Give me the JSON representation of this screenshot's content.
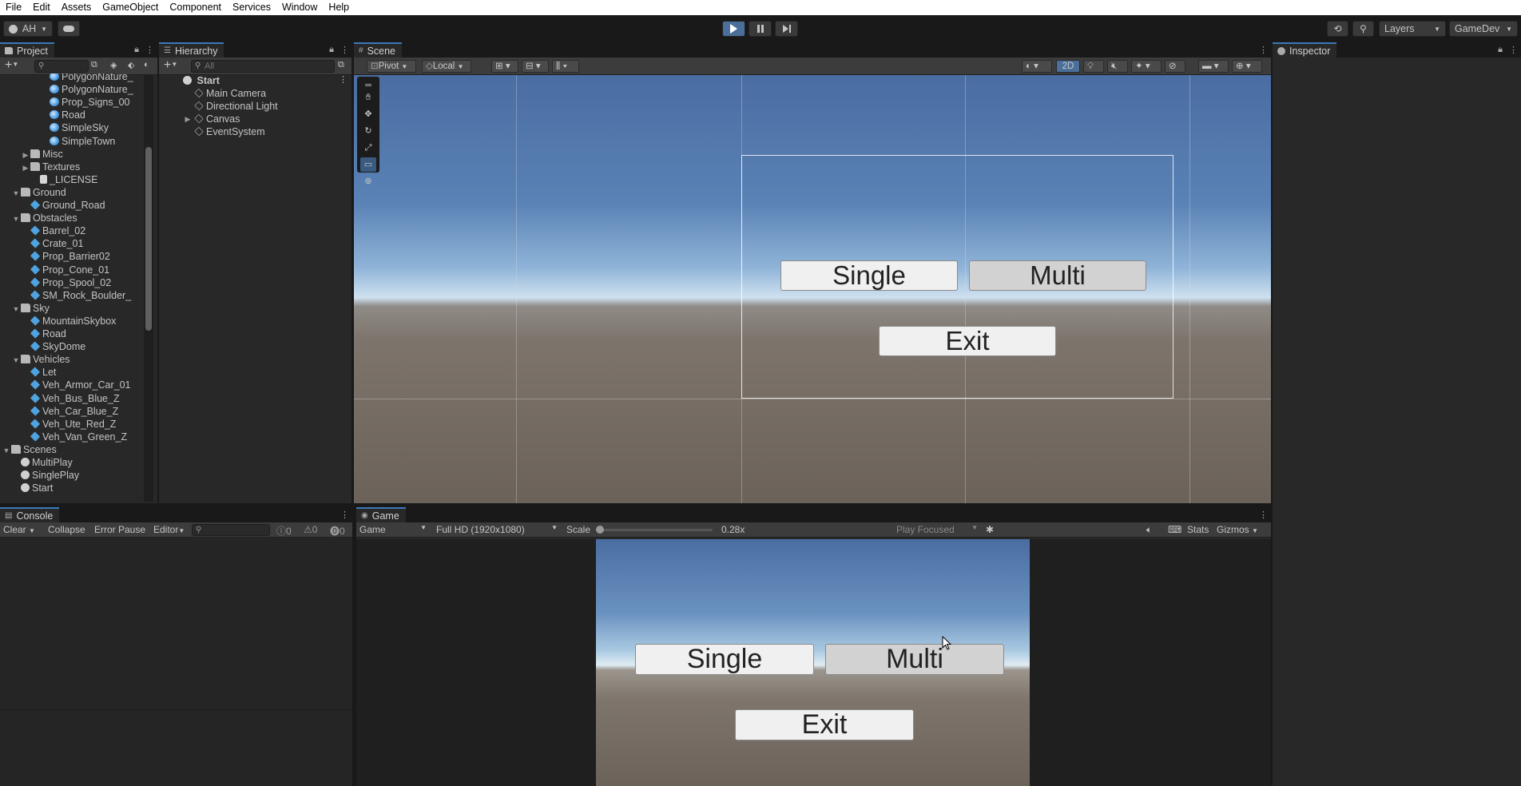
{
  "menu": [
    "File",
    "Edit",
    "Assets",
    "GameObject",
    "Component",
    "Services",
    "Window",
    "Help"
  ],
  "toolbar": {
    "account": "AH",
    "layers": "Layers",
    "layout": "GameDev"
  },
  "project": {
    "tab": "Project",
    "rows": [
      {
        "label": "PolygonNature_",
        "icon": "mat",
        "indent": 5
      },
      {
        "label": "PolygonNature_",
        "icon": "mat",
        "indent": 5
      },
      {
        "label": "Prop_Signs_00",
        "icon": "mat",
        "indent": 5
      },
      {
        "label": "Road",
        "icon": "mat",
        "indent": 5
      },
      {
        "label": "SimpleSky",
        "icon": "mat",
        "indent": 5
      },
      {
        "label": "SimpleTown",
        "icon": "mat",
        "indent": 5
      },
      {
        "label": "Misc",
        "icon": "folder",
        "indent": 3,
        "arrow": "▶"
      },
      {
        "label": "Textures",
        "icon": "folder",
        "indent": 3,
        "arrow": "▶"
      },
      {
        "label": "_LICENSE",
        "icon": "file",
        "indent": 4
      },
      {
        "label": "Ground",
        "icon": "folder",
        "indent": 2,
        "arrow": "▼"
      },
      {
        "label": "Ground_Road",
        "icon": "prefab",
        "indent": 3
      },
      {
        "label": "Obstacles",
        "icon": "folder",
        "indent": 2,
        "arrow": "▼"
      },
      {
        "label": "Barrel_02",
        "icon": "prefab",
        "indent": 3
      },
      {
        "label": "Crate_01",
        "icon": "prefab",
        "indent": 3
      },
      {
        "label": "Prop_Barrier02",
        "icon": "prefab",
        "indent": 3
      },
      {
        "label": "Prop_Cone_01",
        "icon": "prefab",
        "indent": 3
      },
      {
        "label": "Prop_Spool_02",
        "icon": "prefab",
        "indent": 3
      },
      {
        "label": "SM_Rock_Boulder_",
        "icon": "prefab",
        "indent": 3
      },
      {
        "label": "Sky",
        "icon": "folder",
        "indent": 2,
        "arrow": "▼"
      },
      {
        "label": "MountainSkybox",
        "icon": "prefab",
        "indent": 3
      },
      {
        "label": "Road",
        "icon": "prefab",
        "indent": 3
      },
      {
        "label": "SkyDome",
        "icon": "prefab",
        "indent": 3
      },
      {
        "label": "Vehicles",
        "icon": "folder",
        "indent": 2,
        "arrow": "▼"
      },
      {
        "label": "Let",
        "icon": "prefab",
        "indent": 3
      },
      {
        "label": "Veh_Armor_Car_01",
        "icon": "prefab",
        "indent": 3
      },
      {
        "label": "Veh_Bus_Blue_Z",
        "icon": "prefab",
        "indent": 3
      },
      {
        "label": "Veh_Car_Blue_Z",
        "icon": "prefab",
        "indent": 3
      },
      {
        "label": "Veh_Ute_Red_Z",
        "icon": "prefab",
        "indent": 3
      },
      {
        "label": "Veh_Van_Green_Z",
        "icon": "prefab",
        "indent": 3
      },
      {
        "label": "Scenes",
        "icon": "folder",
        "indent": 1,
        "arrow": "▼"
      },
      {
        "label": "MultiPlay",
        "icon": "scene",
        "indent": 2
      },
      {
        "label": "SinglePlay",
        "icon": "scene",
        "indent": 2
      },
      {
        "label": "Start",
        "icon": "scene",
        "indent": 2
      }
    ]
  },
  "hierarchy": {
    "tab": "Hierarchy",
    "search_placeholder": "All",
    "scene": "Start",
    "items": [
      {
        "label": "Main Camera",
        "arrow": ""
      },
      {
        "label": "Directional Light",
        "arrow": ""
      },
      {
        "label": "Canvas",
        "arrow": "▶"
      },
      {
        "label": "EventSystem",
        "arrow": ""
      }
    ]
  },
  "scene": {
    "tab": "Scene",
    "pivot": "Pivot",
    "local": "Local",
    "mode_2d": "2D",
    "buttons": {
      "single": "Single",
      "multi": "Multi",
      "exit": "Exit"
    }
  },
  "inspector": {
    "tab": "Inspector"
  },
  "console": {
    "tab": "Console",
    "clear": "Clear",
    "collapse": "Collapse",
    "error_pause": "Error Pause",
    "editor": "Editor",
    "log_count": "0",
    "warn_count": "0",
    "error_count": "0"
  },
  "game": {
    "tab": "Game",
    "display": "Game",
    "resolution": "Full HD (1920x1080)",
    "scale_label": "Scale",
    "scale_value": "0.28x",
    "scale_fraction": 0.0,
    "play_focused": "Play Focused",
    "stats": "Stats",
    "gizmos": "Gizmos",
    "buttons": {
      "single": "Single",
      "multi": "Multi",
      "exit": "Exit"
    }
  }
}
